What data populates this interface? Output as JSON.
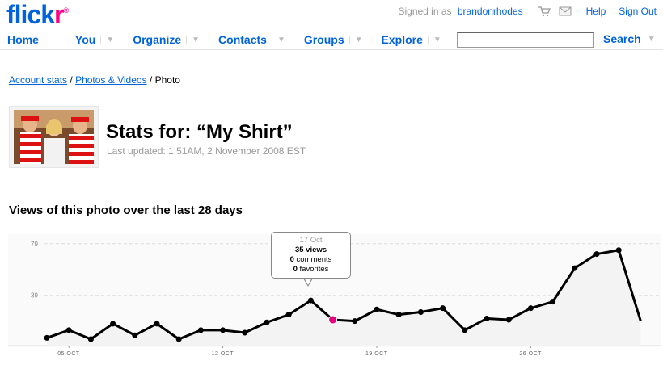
{
  "header": {
    "logo_main": "flick",
    "logo_accent": "r",
    "logo_reg": "®",
    "signed_in_prefix": "Signed in as",
    "username": "brandonrhodes",
    "help": "Help",
    "sign_out": "Sign Out",
    "icons": [
      "cart-icon",
      "mail-icon"
    ]
  },
  "nav": {
    "items": [
      {
        "label": "Home",
        "has_arrow": false
      },
      {
        "label": "You",
        "has_arrow": true
      },
      {
        "label": "Organize",
        "has_arrow": true
      },
      {
        "label": "Contacts",
        "has_arrow": true
      },
      {
        "label": "Groups",
        "has_arrow": true
      },
      {
        "label": "Explore",
        "has_arrow": true
      }
    ],
    "arrow_glyph": "▼",
    "search_value": "",
    "search_label": "Search"
  },
  "breadcrumb": {
    "items": [
      {
        "label": "Account stats",
        "link": true
      },
      {
        "label": "Photos & Videos",
        "link": true
      },
      {
        "label": "Photo",
        "link": false
      }
    ],
    "separator": " / "
  },
  "page": {
    "title": "Stats for: “My Shirt”",
    "updated": "Last updated: 1:51AM, 2 November 2008 EST",
    "section_title": "Views of this photo over the last 28 days"
  },
  "tooltip": {
    "date": "17 Oct",
    "views": "35 views",
    "comments_count": "0",
    "comments_label": "comments",
    "favorites_count": "0",
    "favorites_label": "favorites"
  },
  "colors": {
    "link": "#0063dc",
    "brand_pink": "#ff0084",
    "line": "#000000",
    "highlight": "#e8007f"
  },
  "chart_data": {
    "type": "area",
    "x": [
      "04 Oct",
      "05 Oct",
      "06 Oct",
      "07 Oct",
      "08 Oct",
      "09 Oct",
      "10 Oct",
      "11 Oct",
      "12 Oct",
      "13 Oct",
      "14 Oct",
      "15 Oct",
      "16 Oct",
      "17 Oct",
      "18 Oct",
      "19 Oct",
      "20 Oct",
      "21 Oct",
      "22 Oct",
      "23 Oct",
      "24 Oct",
      "25 Oct",
      "26 Oct",
      "27 Oct",
      "28 Oct",
      "29 Oct",
      "30 Oct",
      "31 Oct",
      "01 Nov"
    ],
    "values": [
      6,
      12,
      5,
      17,
      8,
      17,
      5,
      12,
      12,
      10,
      18,
      24,
      35,
      20,
      19,
      28,
      24,
      26,
      29,
      12,
      21,
      20,
      29,
      34,
      60,
      71,
      74,
      19
    ],
    "highlight_index": 13,
    "yticks": [
      39,
      79
    ],
    "ylim": [
      0,
      82
    ],
    "xticks": [
      "05 OCT",
      "12 OCT",
      "19 OCT",
      "26 OCT"
    ],
    "grid": true
  }
}
